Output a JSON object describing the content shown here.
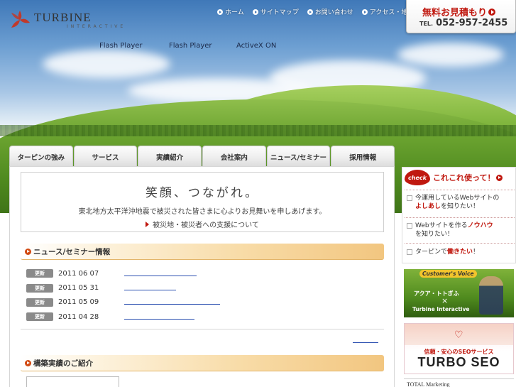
{
  "logo": {
    "name": "TURBINE",
    "sub": "INTERACTIVE"
  },
  "topnav": [
    {
      "label": "ホーム"
    },
    {
      "label": "サイトマップ"
    },
    {
      "label": "お問い合わせ"
    },
    {
      "label": "アクセス・地図"
    }
  ],
  "estimate": {
    "title": "無料お見積もり",
    "tel_prefix": "TEL.",
    "tel": "052-957-2455"
  },
  "flashlinks": [
    "Flash Player",
    "Flash Player",
    "ActiveX ON"
  ],
  "mainnav": [
    "ターピンの強み",
    "サービス",
    "実績紹介",
    "会社案内",
    "ニュース/セミナー",
    "採用情報"
  ],
  "notice": {
    "title": "笑顔、つながれ。",
    "body": "東北地方太平洋沖地震で被災された皆さまに心よりお見舞いを申しあげます。",
    "link": "被災地・被災者への支援について"
  },
  "news": {
    "heading": "ニュース/セミナー情報",
    "items": [
      {
        "badge": "更新",
        "date": "2011 06 07"
      },
      {
        "badge": "更新",
        "date": "2011 05 31"
      },
      {
        "badge": "更新",
        "date": "2011 05 09"
      },
      {
        "badge": "更新",
        "date": "2011 04 28"
      }
    ]
  },
  "works": {
    "heading": "構築実績のご紹介"
  },
  "side": {
    "check_badge": "check",
    "check_title": "これこれ使って！",
    "items": [
      {
        "pre": "今運用しているWebサイトの",
        "hl": "よしあし",
        "post": "を知りたい！"
      },
      {
        "pre": "Webサイトを作る",
        "hl": "ノウハウ",
        "post": "を知りたい！"
      },
      {
        "pre": "ターピンで",
        "hl": "働きたい",
        "post": "！"
      }
    ],
    "cv": {
      "tag": "Customer's Voice",
      "name": "アクア・トトぎふ",
      "x": "×",
      "sub": "Turbine Interactive"
    },
    "seo": {
      "copy": "信頼・安心のSEOサービス",
      "name": "TURBO SEO"
    },
    "tm": "TOTAL Marketing"
  },
  "colors": {
    "accent": "#c0180f",
    "link": "#2a4fb0",
    "nav_bg": "#ececec"
  }
}
